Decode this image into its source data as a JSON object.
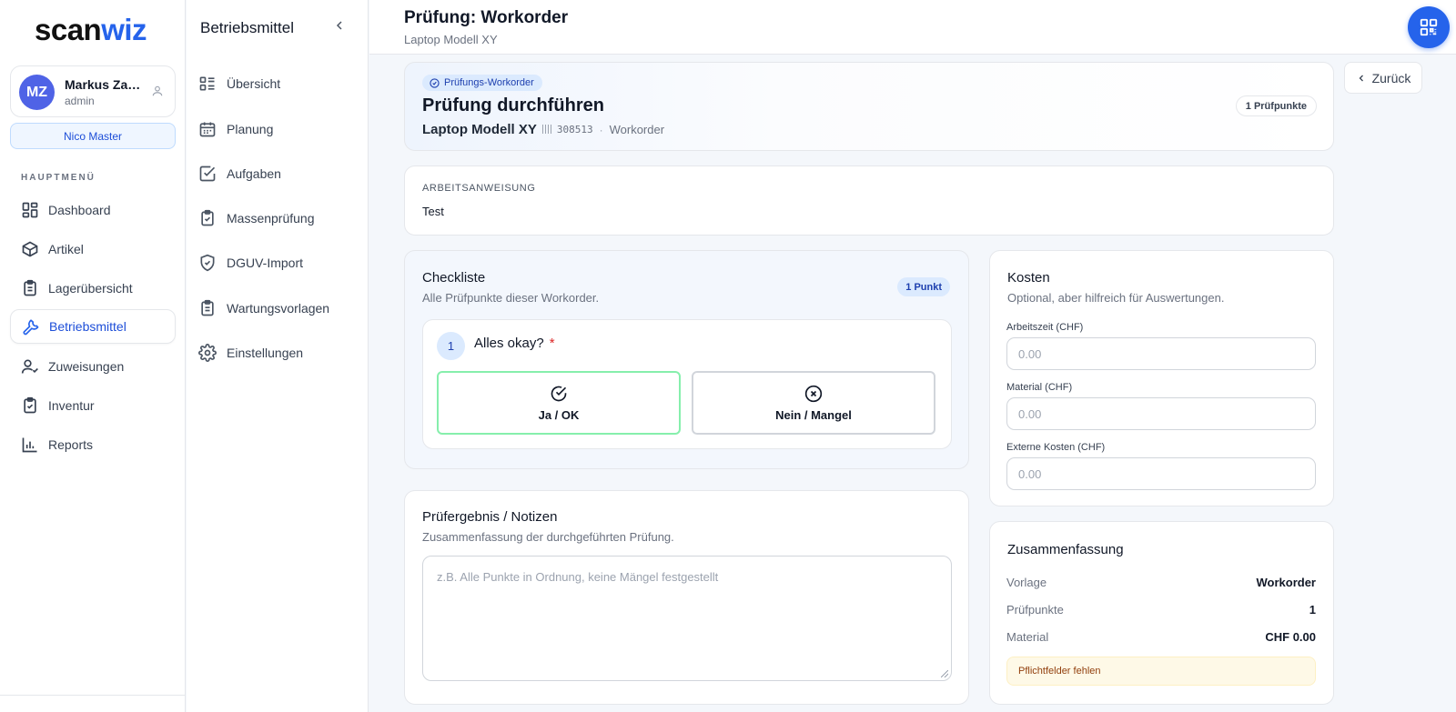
{
  "brand": {
    "part1": "scan",
    "part2": "wiz"
  },
  "user": {
    "initials": "MZ",
    "name": "Markus Zau...",
    "role": "admin",
    "org": "Nico Master"
  },
  "nav": {
    "heading": "HAUPTMENÜ",
    "items": [
      {
        "label": "Dashboard",
        "icon": "dashboard-icon"
      },
      {
        "label": "Artikel",
        "icon": "box-icon"
      },
      {
        "label": "Lagerübersicht",
        "icon": "clipboard-icon"
      },
      {
        "label": "Betriebsmittel",
        "icon": "wrench-icon",
        "active": true
      },
      {
        "label": "Zuweisungen",
        "icon": "user-check-icon"
      },
      {
        "label": "Inventur",
        "icon": "clipboard-check-icon"
      },
      {
        "label": "Reports",
        "icon": "bar-chart-icon"
      }
    ]
  },
  "subnav": {
    "title": "Betriebsmittel",
    "items": [
      {
        "label": "Übersicht",
        "icon": "list-icon"
      },
      {
        "label": "Planung",
        "icon": "calendar-icon"
      },
      {
        "label": "Aufgaben",
        "icon": "checkbox-icon"
      },
      {
        "label": "Massenprüfung",
        "icon": "clipboard-check-icon"
      },
      {
        "label": "DGUV-Import",
        "icon": "shield-check-icon"
      },
      {
        "label": "Wartungsvorlagen",
        "icon": "clipboard-list-icon"
      },
      {
        "label": "Einstellungen",
        "icon": "gear-icon"
      }
    ]
  },
  "header": {
    "title": "Prüfung: Workorder",
    "subtitle": "Laptop Modell XY"
  },
  "hero": {
    "badge": "Prüfungs-Workorder",
    "title": "Prüfung durchführen",
    "product": "Laptop Modell XY",
    "barcode": "308513",
    "dot": "·",
    "type": "Workorder",
    "count": "1 Prüfpunkte"
  },
  "back_label": "Zurück",
  "instructions": {
    "label": "ARBEITSANWEISUNG",
    "text": "Test"
  },
  "checklist": {
    "title": "Checkliste",
    "desc": "Alle Prüfpunkte dieser Workorder.",
    "count": "1 Punkt",
    "item": {
      "number": "1",
      "question": "Alles okay?",
      "required": "*",
      "yes": "Ja / OK",
      "no": "Nein / Mangel"
    }
  },
  "notes": {
    "title": "Prüfergebnis / Notizen",
    "desc": "Zusammenfassung der durchgeführten Prüfung.",
    "placeholder": "z.B. Alle Punkte in Ordnung, keine Mängel festgestellt"
  },
  "costs": {
    "title": "Kosten",
    "desc": "Optional, aber hilfreich für Auswertungen.",
    "fields": [
      {
        "label": "Arbeitszeit (CHF)",
        "placeholder": "0.00"
      },
      {
        "label": "Material (CHF)",
        "placeholder": "0.00"
      },
      {
        "label": "Externe Kosten (CHF)",
        "placeholder": "0.00"
      }
    ]
  },
  "summary": {
    "title": "Zusammenfassung",
    "rows": [
      {
        "key": "Vorlage",
        "value": "Workorder"
      },
      {
        "key": "Prüfpunkte",
        "value": "1"
      },
      {
        "key": "Material",
        "value": "CHF 0.00"
      }
    ],
    "warning": "Pflichtfelder fehlen"
  },
  "colors": {
    "accent": "#2563eb",
    "success_border": "#86efac",
    "warning_bg": "#fef9e7"
  }
}
